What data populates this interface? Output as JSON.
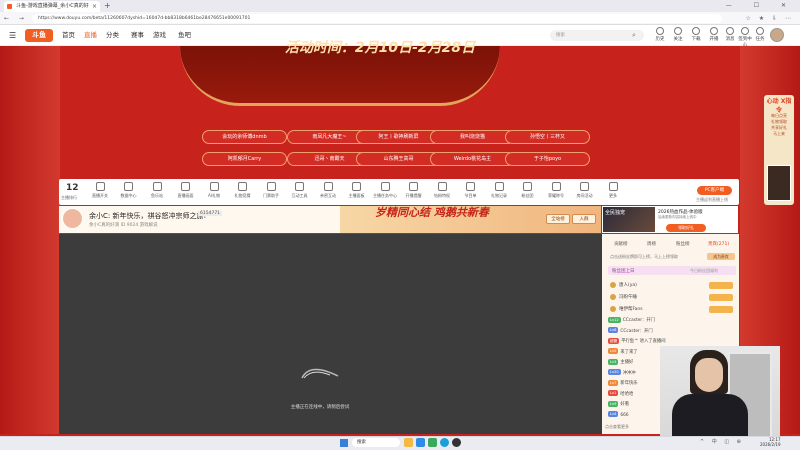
{
  "browser": {
    "tab_title": "斗鱼-游戏直播弹幕_余小C真的好",
    "url": "https://www.douyu.com/beta/11260607dyshid=160d7d-bb8318b6461be28476651e00091701",
    "nav_icons": "← → ⟳",
    "tools": "☆ ★ ⇩ ⋯",
    "window_controls": "— ☐ ✕",
    "new_tab": "+"
  },
  "site": {
    "logo": "斗鱼",
    "nav": [
      "首页",
      "直播",
      "分类",
      "赛事",
      "游戏",
      "鱼吧"
    ],
    "search_placeholder": "搜索",
    "header_icons": [
      "历史",
      "关注",
      "下载",
      "开播",
      "消息",
      "签到中心",
      "任务"
    ]
  },
  "banner": {
    "title": "活动时间：2月10日-2月28日",
    "streamers": [
      "会玩的余师傅dnmb",
      "南凤凡大魔王~",
      "阿王丨歌神刷新屏",
      "我叫烧烧猫",
      "孙悟空丨三杯又",
      "阿凯郁月Carry",
      "迅哥丶南霸天",
      "山东腾王高哥",
      "Weirdo桃花岛主",
      "于子怡poyo"
    ]
  },
  "side_ad": {
    "title": "心动 X指令",
    "lines": [
      "每日点亮",
      "礼物领取",
      "共享好礼",
      "马上来"
    ]
  },
  "toolstrip": {
    "rank_num": "12",
    "rank_label": "主播排行",
    "tools": [
      "直播开关",
      "数据中心",
      "鱼乐站",
      "直播画面",
      "AI礼物",
      "礼物竞猜",
      "门票助手",
      "互动工具",
      "亲密互动",
      "主播面板",
      "主播任务中心",
      "开播提醒",
      "钻粉特权",
      "节目单",
      "礼物记录",
      "粉丝团",
      "荣耀称号",
      "房间活动",
      "更多"
    ],
    "pc_client": "PC客户端",
    "pc_client_sub": "主播返利直播上线"
  },
  "room": {
    "title": "余小C: 新年快乐，祺谷怒冲宗师之旅!",
    "follow_count": "6154771",
    "meta": "余小C真的好演   ID 9024   游戏解说",
    "ad_text": "岁精同心结 鸡鹅共新春",
    "ad_buttons": [
      "全站榜",
      "入群"
    ]
  },
  "promo": {
    "image_text": "全民独宠",
    "title": "2026热血作品-体验版",
    "desc": "后续更新内容持续上线中",
    "button": "领取好礼"
  },
  "player": {
    "message": "主播正在连线中，请稍后尝试"
  },
  "chat": {
    "tabs": [
      "贡献榜",
      "周榜",
      "粉丝榜",
      "贵宾(271)"
    ],
    "active_tab_index": 3,
    "sub_text": "点击送粉丝牌即可上榜，马上上榜领取",
    "sub_button": "成为贵宾",
    "rank_header": "粉丝团上日",
    "rank_more": "今日粉丝团福利",
    "rank_rows": [
      "唐人(ya)",
      "冯盼午睡",
      "唯伊帮Fans"
    ],
    "messages": [
      {
        "tag": "Lv12",
        "tag_style": "g",
        "text": "CCcaster：开门"
      },
      {
        "tag": "Lv8",
        "tag_style": "b",
        "text": "CCcaster：开门"
      },
      {
        "tag": "超管",
        "tag_style": "r",
        "text": "平行鱼™ 进入了直播间"
      },
      {
        "tag": "Lv5",
        "tag_style": "o",
        "text": "来了来了"
      },
      {
        "tag": "Lv3",
        "tag_style": "g",
        "text": "主播好"
      },
      {
        "tag": "Lv20",
        "tag_style": "b",
        "text": "冲冲冲"
      },
      {
        "tag": "Lv7",
        "tag_style": "o",
        "text": "新年快乐"
      },
      {
        "tag": "Lv1",
        "tag_style": "r",
        "text": "哈哈哈"
      },
      {
        "tag": "Lv9",
        "tag_style": "g",
        "text": "好看"
      },
      {
        "tag": "Lv4",
        "tag_style": "b",
        "text": "666"
      }
    ],
    "footer": "点击查看更多"
  },
  "taskbar": {
    "search": "搜索",
    "clock_time": "12:17",
    "clock_date": "2026/2/19",
    "tray": "^ 中 ◫ ⊕"
  },
  "colors": {
    "accent": "#f25d22",
    "page_bg": "#c8221c",
    "chat_bg": "#fdf5ec"
  }
}
